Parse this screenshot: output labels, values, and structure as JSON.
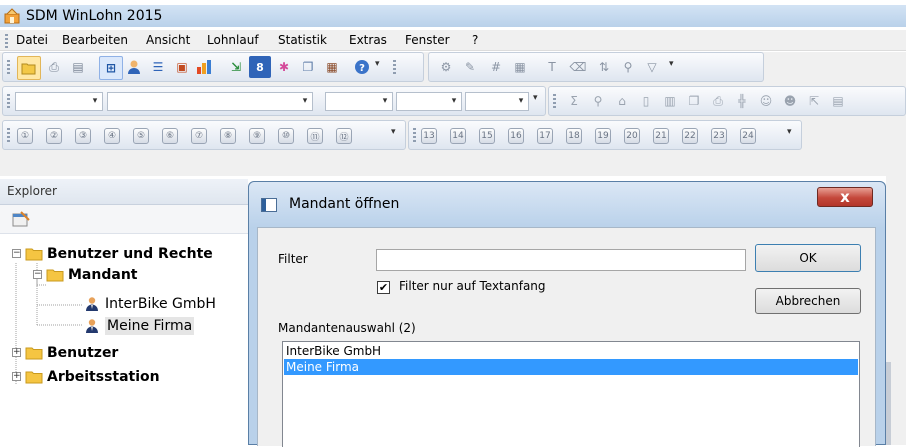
{
  "app": {
    "title": "SDM WinLohn 2015"
  },
  "menu": [
    "Datei",
    "Bearbeiten",
    "Ansicht",
    "Lohnlauf",
    "Statistik",
    "Extras",
    "Fenster",
    "?"
  ],
  "toolbar3": {
    "left_buttons": [
      "①",
      "②",
      "③",
      "④",
      "⑤",
      "⑥",
      "⑦",
      "⑧",
      "⑨",
      "⑩",
      "⑪",
      "⑫"
    ],
    "right_buttons": [
      "13",
      "14",
      "15",
      "16",
      "17",
      "18",
      "19",
      "20",
      "21",
      "22",
      "23",
      "24"
    ]
  },
  "explorer": {
    "title": "Explorer",
    "tree": [
      {
        "label": "Benutzer und Rechte",
        "expander": "−"
      },
      {
        "label": "Mandant",
        "expander": "−"
      },
      {
        "label": "InterBike GmbH"
      },
      {
        "label": "Meine Firma"
      },
      {
        "label": "Benutzer",
        "expander": "+"
      },
      {
        "label": "Arbeitsstation",
        "expander": "+"
      }
    ]
  },
  "dialog": {
    "title": "Mandant öffnen",
    "close_glyph": "x",
    "filter_label": "Filter",
    "filter_value": "",
    "checkbox_checked_glyph": "✔",
    "checkbox_label": "Filter nur auf Textanfang",
    "ok_label": "OK",
    "cancel_label": "Abbrechen",
    "list_label": "Mandantenauswahl (2)",
    "list_items": [
      "InterBike GmbH",
      "Meine Firma"
    ],
    "selected_index": 1
  },
  "colors": {
    "selection": "#3399ff",
    "close_red": "#c4473a",
    "folder": "#f5c542"
  }
}
